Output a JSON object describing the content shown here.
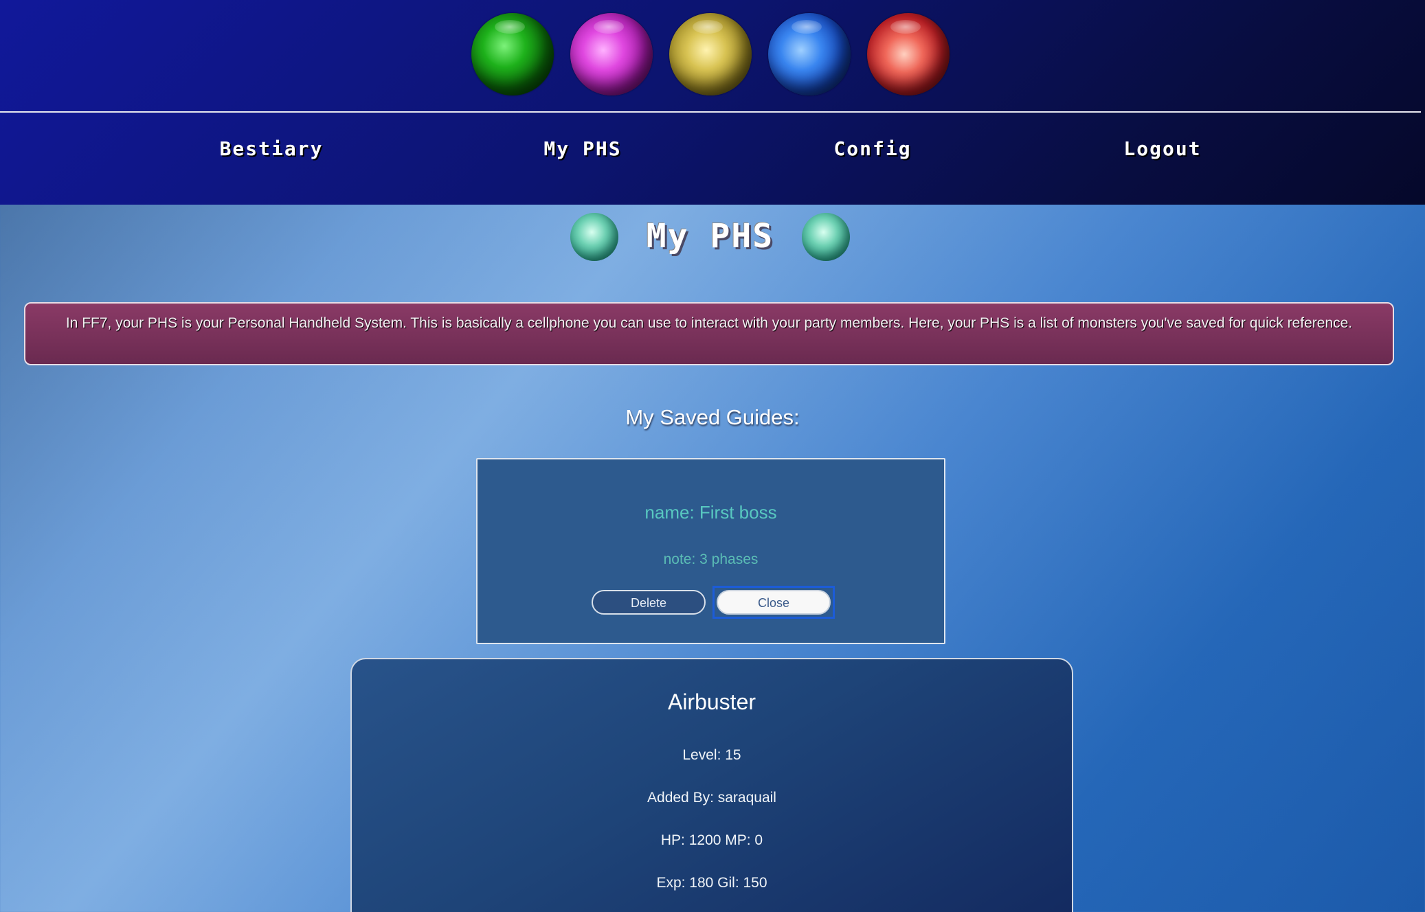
{
  "header": {
    "orbs": [
      "green-materia-orb",
      "magenta-materia-orb",
      "yellow-materia-orb",
      "blue-materia-orb",
      "red-materia-orb"
    ],
    "nav": [
      {
        "label": "Bestiary"
      },
      {
        "label": "My PHS"
      },
      {
        "label": "Config"
      },
      {
        "label": "Logout"
      }
    ]
  },
  "page": {
    "title": "My PHS",
    "info": "In FF7, your PHS is your Personal Handheld System. This is basically a cellphone you can use to interact with your party members. Here, your PHS is a list of monsters you've saved for quick reference.",
    "saved_heading": "My Saved Guides:"
  },
  "guide": {
    "name": "name: First boss",
    "note": "note: 3 phases",
    "delete_label": "Delete",
    "close_label": "Close"
  },
  "monster": {
    "name": "Airbuster",
    "level": "Level: 15",
    "added_by": "Added By: saraquail",
    "hp_mp": "HP: 1200 MP: 0",
    "exp_gil": "Exp: 180 Gil: 150"
  },
  "colors": {
    "header_bg": "#0c1470",
    "banner_bg": "#7a3258",
    "guide_card_bg": "#2d5a8e",
    "guide_text": "#58c8c0",
    "focus_ring": "#1c5cd8"
  }
}
